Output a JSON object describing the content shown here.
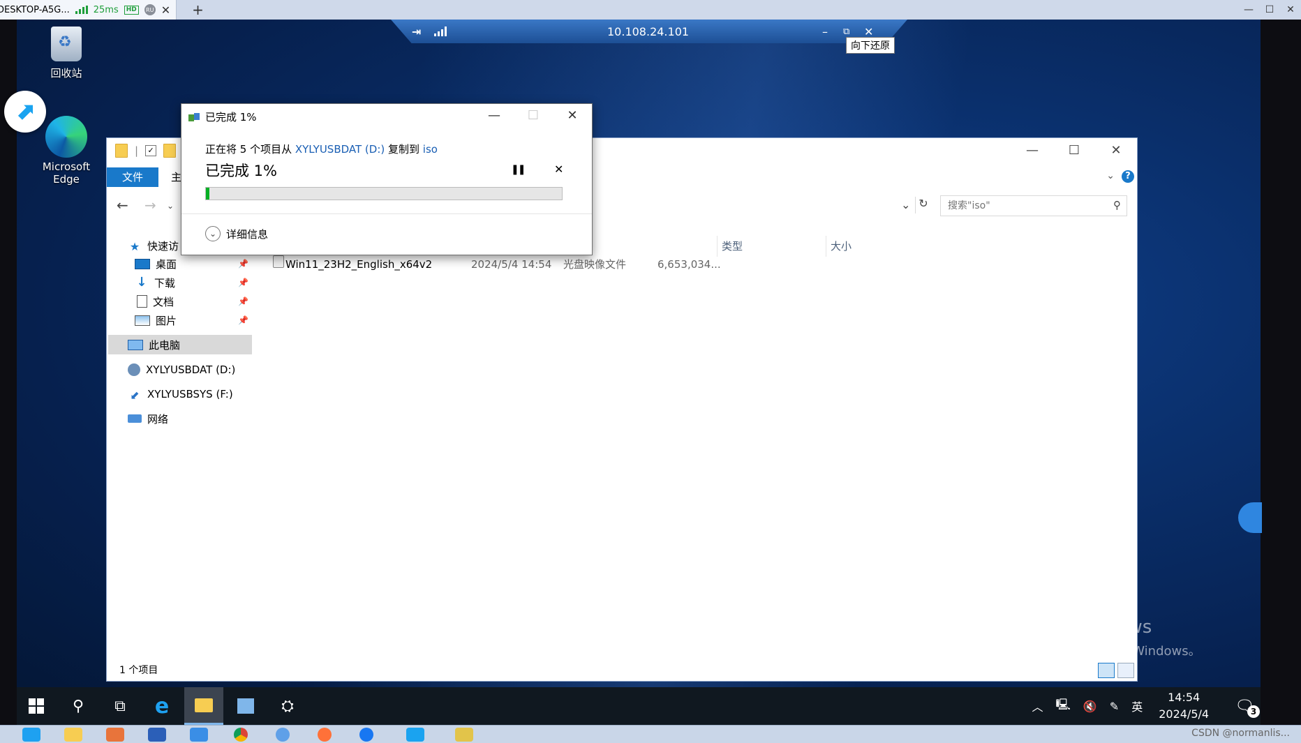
{
  "client": {
    "host": "DESKTOP-A5G...",
    "latency": "25ms",
    "hd": "HD",
    "ru": "RU",
    "tab_close": "✕",
    "new_tab": "+",
    "controls": [
      "—",
      "☐",
      "✕"
    ]
  },
  "rdp_bar": {
    "ip": "10.108.24.101",
    "pin": "⇥",
    "minimize": "–",
    "restore": "⧉",
    "close": "✕",
    "tooltip": "向下还原"
  },
  "desktop": {
    "recycle_bin": "回收站",
    "edge_line1": "Microsoft",
    "edge_line2": "Edge"
  },
  "explorer": {
    "file_tab": "文件",
    "home_tab": "主",
    "win_controls": [
      "—",
      "☐",
      "✕"
    ],
    "help": "?",
    "search_placeholder": "搜索\"iso\"",
    "columns": {
      "type": "类型",
      "size": "大小"
    },
    "nav": {
      "quick_access": "快速访",
      "desktop": "桌面",
      "downloads": "下载",
      "documents": "文档",
      "pictures": "图片",
      "this_pc": "此电脑",
      "drive_d": "XYLYUSBDAT (D:)",
      "drive_f": "XYLYUSBSYS (F:)",
      "network": "网络"
    },
    "files": [
      {
        "name": "Win11_23H2_English_x64v2",
        "date": "2024/5/4 14:54",
        "type": "光盘映像文件",
        "size": "6,653,034..."
      }
    ],
    "status": "1 个项目"
  },
  "copy_dialog": {
    "title": "已完成 1%",
    "desc_prefix": "正在将 5 个项目从 ",
    "source": "XYLYUSBDAT (D:)",
    "desc_mid": " 复制到 ",
    "dest": "iso",
    "big_status": "已完成 1%",
    "progress_percent": 1,
    "pause": "❚❚",
    "cancel": "✕",
    "more_details": "详细信息",
    "win_controls": [
      "—",
      "☐",
      "✕"
    ]
  },
  "watermark": {
    "line1": "激活 Windows",
    "line2": "转到\"设置\"以激活 Windows。"
  },
  "taskbar": {
    "time": "14:54",
    "date": "2024/5/4",
    "ime": "英",
    "notifications": "3"
  },
  "local": {
    "csdn": "CSDN @normanlis..."
  },
  "colors": {
    "accent": "#1979ca",
    "progress": "#06b025",
    "link": "#1a5fb4"
  }
}
